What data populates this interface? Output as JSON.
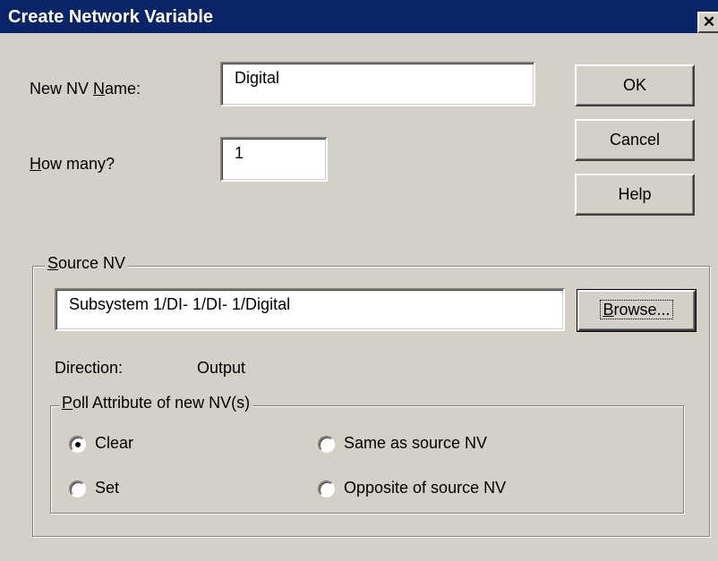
{
  "window": {
    "title": "Create Network Variable",
    "close_glyph": "✕"
  },
  "name_field": {
    "label_pre": "New NV ",
    "label_key": "N",
    "label_post": "ame:",
    "value": "Digital"
  },
  "count_field": {
    "label_key": "H",
    "label_post": "ow many?",
    "value": "1"
  },
  "buttons": {
    "ok": "OK",
    "cancel": "Cancel",
    "help": "Help"
  },
  "source_group": {
    "legend_key": "S",
    "legend_post": "ource NV",
    "path": "Subsystem 1/DI- 1/DI- 1/Digital",
    "browse_key": "B",
    "browse_post": "rowse...",
    "direction_label": "Direction:",
    "direction_value": "Output"
  },
  "poll_group": {
    "legend_key": "P",
    "legend_post": "oll Attribute of new NV(s)",
    "options": [
      {
        "label": "Clear",
        "checked": true
      },
      {
        "label": "Same as source NV",
        "checked": false
      },
      {
        "label": "Set",
        "checked": false
      },
      {
        "label": "Opposite of source NV",
        "checked": false
      }
    ]
  }
}
